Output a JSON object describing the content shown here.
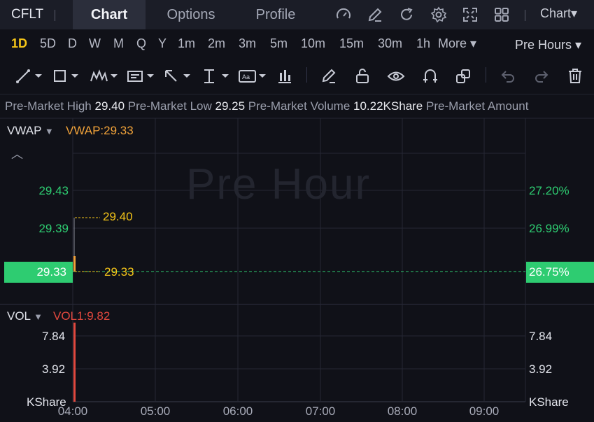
{
  "header": {
    "symbol": "CFLT",
    "tabs": [
      {
        "label": "Chart",
        "active": true
      },
      {
        "label": "Options",
        "active": false
      },
      {
        "label": "Profile",
        "active": false
      }
    ],
    "icons": [
      "speedometer-icon",
      "edit-icon",
      "refresh-icon",
      "settings-icon",
      "fullscreen-icon",
      "grid-icon"
    ],
    "chart_menu": "Chart"
  },
  "timeframes": {
    "items": [
      "1D",
      "5D",
      "D",
      "W",
      "M",
      "Q",
      "Y",
      "1m",
      "2m",
      "3m",
      "5m",
      "10m",
      "15m",
      "30m",
      "1h"
    ],
    "active": "1D",
    "more_label": "More",
    "session_label": "Pre Hours"
  },
  "toolbar": {
    "tools": [
      "trendline-tool-icon",
      "rectangle-tool-icon",
      "pattern-tool-icon",
      "text-note-tool-icon",
      "arrow-tool-icon",
      "measure-tool-icon",
      "annotation-tool-icon",
      "indicator-tool-icon",
      "pen-icon",
      "unlock-icon",
      "visibility-icon",
      "magnet-icon",
      "duplicate-icon",
      "undo-icon",
      "redo-icon",
      "delete-icon"
    ]
  },
  "premarket": {
    "high_label": "Pre-Market High",
    "high_value": "29.40",
    "low_label": "Pre-Market Low",
    "low_value": "29.25",
    "volume_label": "Pre-Market Volume",
    "volume_value": "10.22KShare",
    "amount_label": "Pre-Market Amount"
  },
  "main_pane": {
    "indicator": "VWAP",
    "indicator_value": "VWAP:29.33",
    "watermark": "Pre Hour",
    "left_axis": [
      "29.43",
      "29.39"
    ],
    "right_axis": [
      "27.20%",
      "26.99%"
    ],
    "current_price": "29.33",
    "current_pct": "26.75%",
    "high_callout": "29.40",
    "last_callout": "29.33"
  },
  "volume_pane": {
    "indicator": "VOL",
    "indicator_value": "VOL1:9.82",
    "axis": [
      "7.84",
      "3.92"
    ],
    "unit": "KShare"
  },
  "x_axis": {
    "labels": [
      "04:00",
      "05:00",
      "06:00",
      "07:00",
      "08:00",
      "09:00"
    ]
  },
  "colors": {
    "background": "#101118",
    "up": "#2ecc71",
    "volume_bar": "#e0483e",
    "vwap": "#f0a23a",
    "callout": "#f5c518",
    "active_timeframe": "#f5c518"
  },
  "chart_data": {
    "type": "line",
    "x": [
      "04:00",
      "05:00",
      "06:00",
      "07:00",
      "08:00",
      "09:00"
    ],
    "series": [
      {
        "name": "VWAP",
        "values": [
          29.33
        ]
      },
      {
        "name": "VOL1",
        "values": [
          9.82
        ]
      }
    ],
    "price_ylim": [
      29.31,
      29.45
    ],
    "volume_ylim": [
      0,
      9.82
    ],
    "grid": true
  }
}
